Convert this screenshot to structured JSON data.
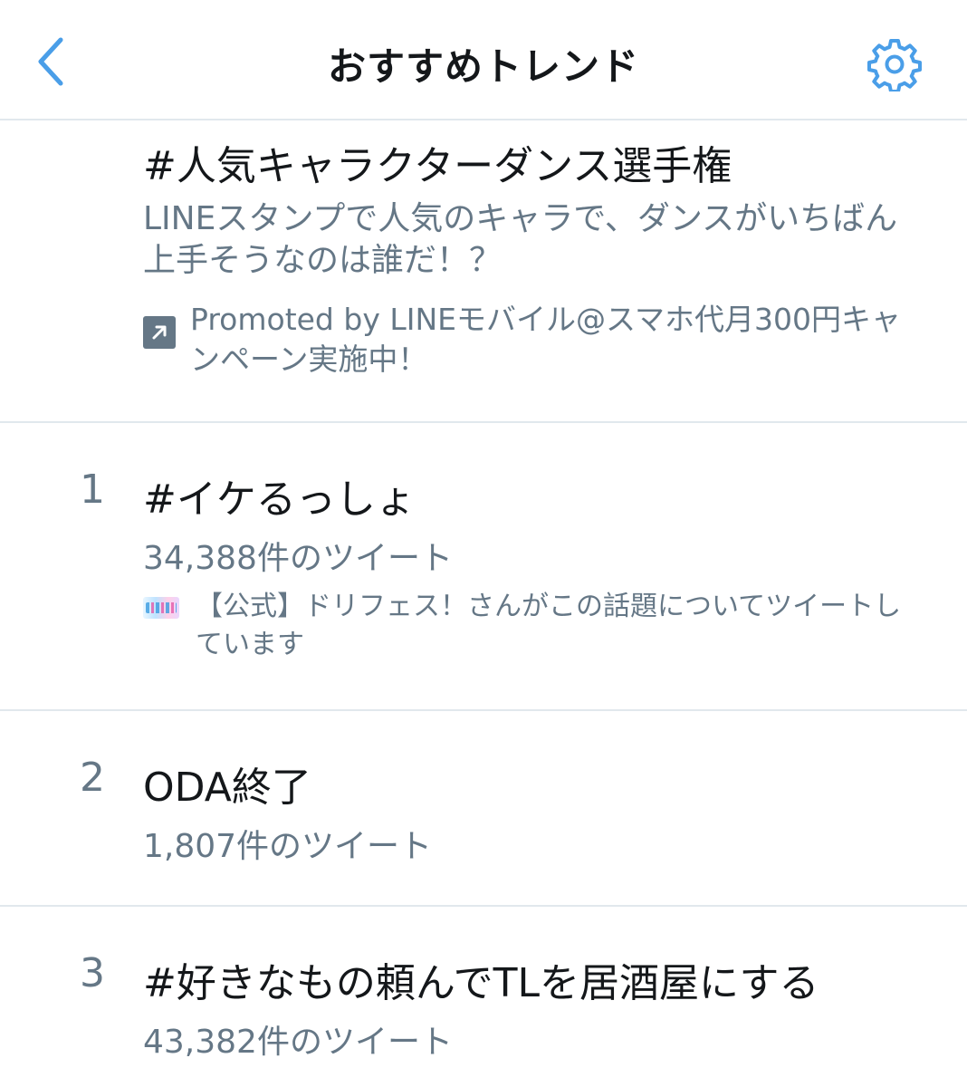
{
  "header": {
    "title": "おすすめトレンド"
  },
  "colors": {
    "accent": "#4a9ee8",
    "primary_text": "#14171a",
    "secondary_text": "#657786",
    "divider": "#e1e8ed"
  },
  "trends": [
    {
      "rank": "",
      "name": "#人気キャラクターダンス選手権",
      "description": "LINEスタンプで人気のキャラで、ダンスがいちばん上手そうなのは誰だ！？",
      "context": "Promoted by LINEモバイル@スマホ代月300円キャンペーン実施中！",
      "context_icon": "promoted-arrow-icon"
    },
    {
      "rank": "1",
      "name": "#イケるっしょ",
      "count": "34,388件のツイート",
      "context": "【公式】ドリフェス！さんがこの話題についてツイートしています",
      "context_icon": "account-avatar"
    },
    {
      "rank": "2",
      "name": "ODA終了",
      "count": "1,807件のツイート"
    },
    {
      "rank": "3",
      "name": "#好きなもの頼んでTLを居酒屋にする",
      "count": "43,382件のツイート"
    }
  ]
}
